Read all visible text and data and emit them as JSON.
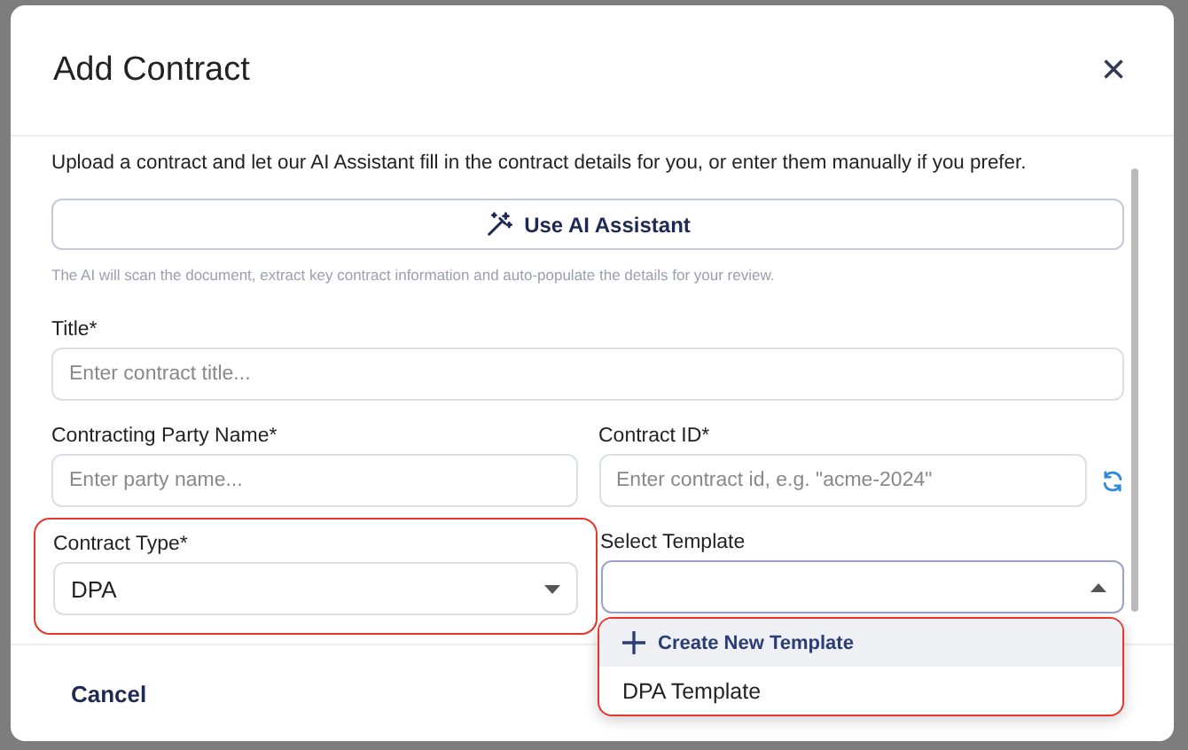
{
  "dialog": {
    "title": "Add Contract",
    "close": "×"
  },
  "intro": "Upload a contract and let our AI Assistant fill in the contract details for you, or enter them manually if you prefer.",
  "ai_button": {
    "label": "Use AI Assistant"
  },
  "ai_hint": "The AI will scan the document, extract key contract information and auto-populate the details for your review.",
  "fields": [
    {
      "kind": "text",
      "label": "Title*",
      "placeholder": "Enter contract title...",
      "highlighted": false
    },
    {
      "kind": "text",
      "label": "Contracting Party Name*",
      "placeholder": "Enter party name...",
      "highlighted": false
    },
    {
      "kind": "refresh",
      "label": "Contract ID*",
      "placeholder": "Enter contract id, e.g. \"acme-2024\"",
      "highlighted": false
    },
    {
      "kind": "select",
      "label": "Contract Type*",
      "value": "DPA",
      "expanded": false,
      "highlighted": true
    },
    {
      "kind": "select",
      "label": "Select Template",
      "expanded": true,
      "highlighted": false
    }
  ],
  "template_menu": {
    "highlighted": true,
    "items": [
      {
        "kind": "create",
        "label": "Create New Template",
        "selected": false
      },
      {
        "kind": "option",
        "label": "DPA Template",
        "selected": false
      }
    ]
  },
  "footer": {
    "cancel": "Cancel"
  }
}
